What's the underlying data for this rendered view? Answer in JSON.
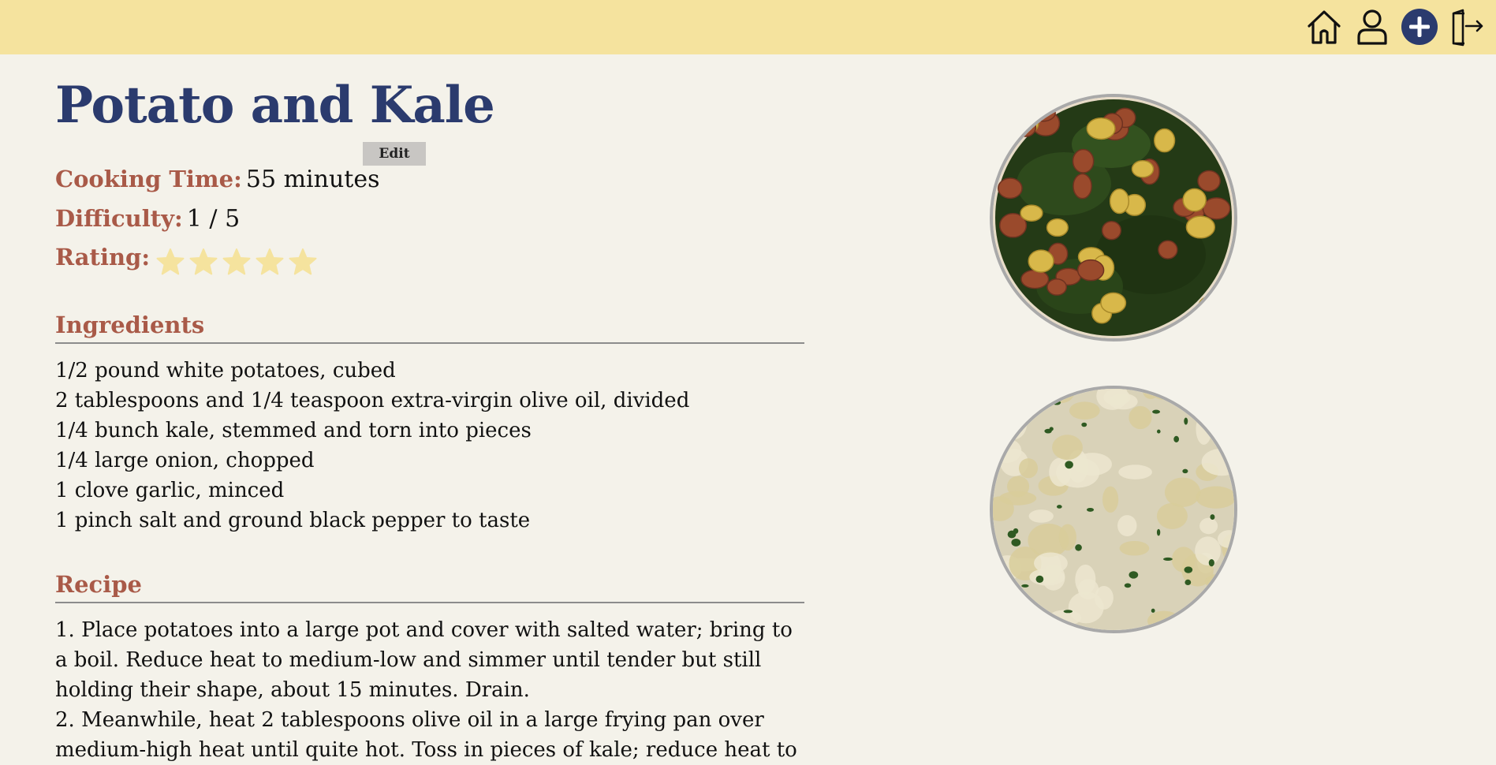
{
  "header": {
    "icons": [
      "home-icon",
      "user-icon",
      "add-icon",
      "logout-icon"
    ],
    "background": "#f5e39e",
    "add_icon_color": "#2b3b6e"
  },
  "recipe": {
    "title": "Potato and Kale",
    "edit_label": "Edit",
    "cooking_time_label": "Cooking Time:",
    "cooking_time_value": "55 minutes",
    "difficulty_label": "Difficulty:",
    "difficulty_value": "1 / 5",
    "rating_label": "Rating:",
    "rating": {
      "value": 5,
      "max": 5,
      "star_color": "#f5e39e"
    },
    "ingredients_title": "Ingredients",
    "ingredients": [
      "1/2 pound white potatoes, cubed",
      "2 tablespoons and 1/4 teaspoon extra-virgin olive oil, divided",
      "1/4 bunch kale, stemmed and torn into pieces",
      "1/4 large onion, chopped",
      "1 clove garlic, minced",
      "1 pinch salt and ground black pepper to taste"
    ],
    "recipe_title": "Recipe",
    "steps": [
      "1. Place potatoes into a large pot and cover with salted water; bring to a boil. Reduce heat to medium-low and simmer until tender but still holding their shape, about 15 minutes. Drain.",
      "2. Meanwhile, heat 2 tablespoons olive oil in a large frying pan over medium-high heat until quite hot. Toss in pieces of kale; reduce heat to"
    ]
  },
  "colors": {
    "page_background": "#f4f2ea",
    "title": "#2b3b6e",
    "label": "#a95a48",
    "text": "#111111"
  }
}
